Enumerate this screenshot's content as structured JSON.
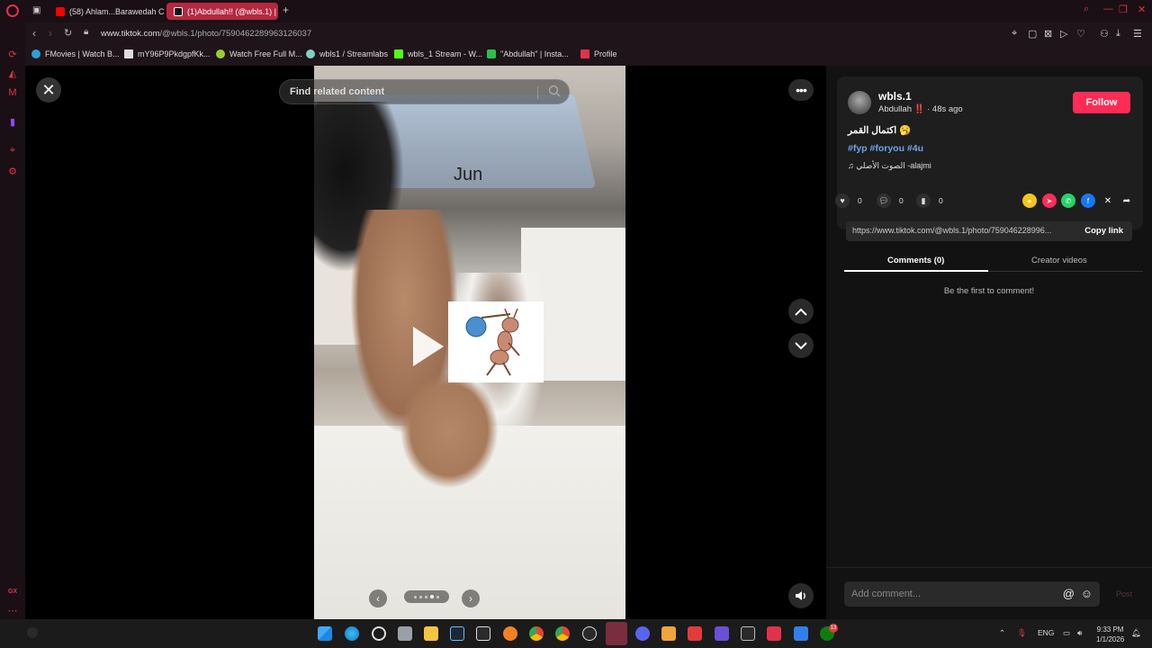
{
  "browser": {
    "tabs": [
      {
        "label": "(58) Ahlam...Barawedah C"
      },
      {
        "label": "(1)Abdullah!! (@wbls.1) | T"
      }
    ],
    "url_host": "www.tiktok.com",
    "url_path": "/@wbls.1/photo/7590462289963126037",
    "bookmarks": [
      {
        "label": "FMovies | Watch B...",
        "color": "#2aa1d9"
      },
      {
        "label": "mY96P9PkdgpfKk...",
        "color": "#dddddd"
      },
      {
        "label": "Watch Free Full M...",
        "color": "#9acd32"
      },
      {
        "label": "wbls1 / Streamlabs",
        "color": "#80d0c0"
      },
      {
        "label": "wbls_1 Stream - W...",
        "color": "#53fc18"
      },
      {
        "label": "\"Abdullah\" | Insta...",
        "color": "#2bbf4d"
      },
      {
        "label": "Profile",
        "color": "#e0334a"
      }
    ]
  },
  "viewer": {
    "search_placeholder": "Find related content",
    "photo_overlay_text": "Jun",
    "carousel_total": 5,
    "carousel_active": 4
  },
  "post": {
    "username": "wbls.1",
    "display_name": "Abdullah",
    "flag": "‼️",
    "time": "· 48s ago",
    "follow_label": "Follow",
    "caption": "اكتمال القمر 🥱",
    "hashtags": "#fyp #foryou #4u",
    "music": "الصوت الأصلي -alajmi",
    "likes": "0",
    "comments": "0",
    "saves": "0",
    "link": "https://www.tiktok.com/@wbls.1/photo/759046228996...",
    "copy_label": "Copy link",
    "tab_comments": "Comments (0)",
    "tab_creator": "Creator videos",
    "empty_comments": "Be the first to comment!",
    "comment_placeholder": "Add comment...",
    "post_label": "Post"
  },
  "taskbar": {
    "lang": "ENG",
    "time": "9:33 PM",
    "date": "1/1/2026",
    "badge_count": "13"
  },
  "colors": {
    "accent": "#fe2c55",
    "opera_red": "#e0334a",
    "hashtag": "#6fa3e6"
  }
}
